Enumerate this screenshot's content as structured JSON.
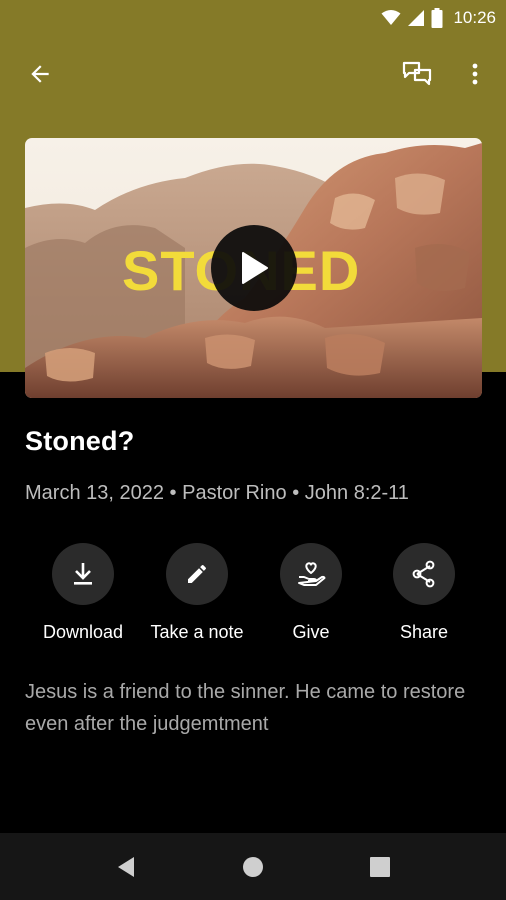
{
  "status_bar": {
    "time": "10:26",
    "icons": [
      "wifi-icon",
      "cellular-signal-icon",
      "battery-icon"
    ]
  },
  "toolbar": {
    "back_icon": "arrow-back-icon",
    "discussion_icon": "chat-bubbles-icon",
    "more_icon": "more-vert-icon"
  },
  "media": {
    "thumbnail_text": "STONED",
    "play_icon": "play-icon"
  },
  "sermon": {
    "title": "Stoned?",
    "date": "March 13, 2022",
    "speaker": "Pastor Rino",
    "scripture": "John 8:2-11",
    "separator": "•",
    "description": "Jesus is a friend to the sinner. He came to restore even after the judgemtment"
  },
  "actions": [
    {
      "label": "Download",
      "icon": "download-icon"
    },
    {
      "label": "Take a note",
      "icon": "pencil-icon"
    },
    {
      "label": "Give",
      "icon": "hand-heart-icon"
    },
    {
      "label": "Share",
      "icon": "share-icon"
    }
  ],
  "nav_bar": {
    "icons": [
      "nav-back-icon",
      "nav-home-icon",
      "nav-recents-icon"
    ]
  },
  "colors": {
    "header": "#857a28",
    "background": "#000000",
    "action_circle": "#2b2b2b",
    "accent_text": "#f2db3a"
  }
}
